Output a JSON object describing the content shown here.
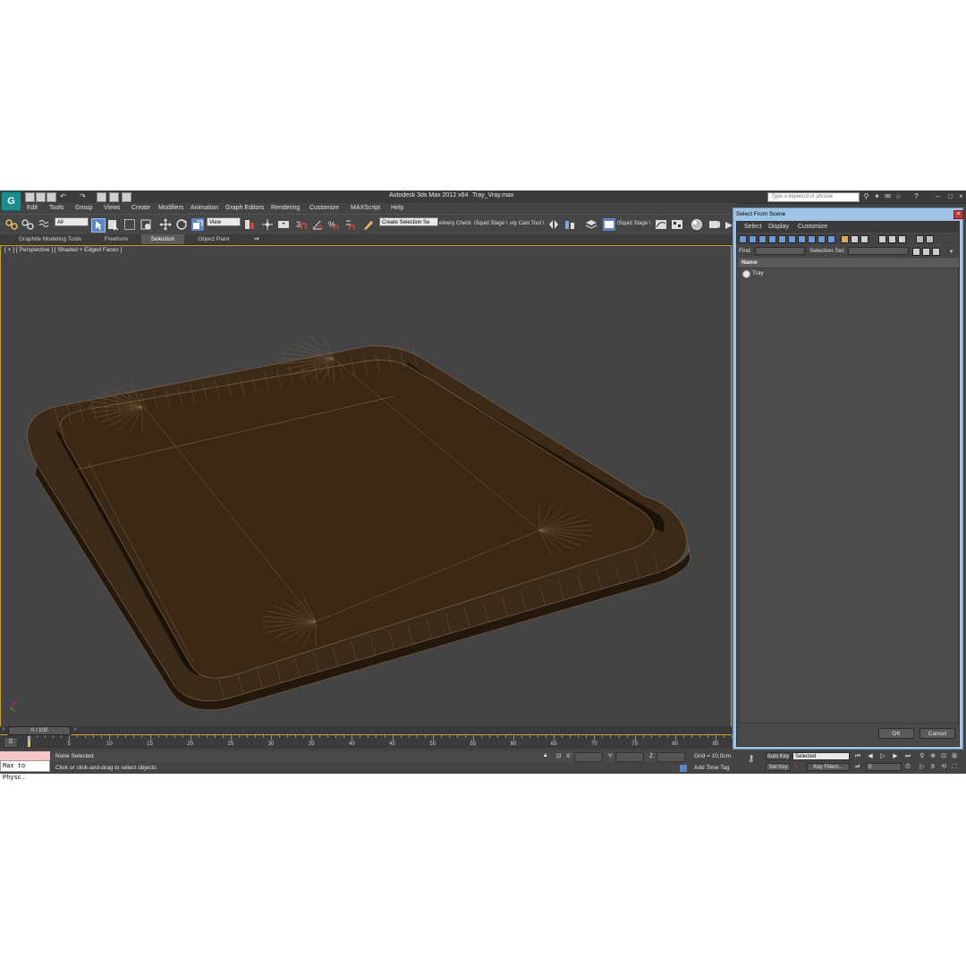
{
  "window": {
    "app_title": "Autodesk 3ds Max  2012 x64",
    "file_name": "Tray_Vray.max",
    "search_placeholder": "Type a keyword or phrase",
    "logo_icon": "3ds-max-logo-icon"
  },
  "menu": [
    "Edit",
    "Tools",
    "Group",
    "Views",
    "Create",
    "Modifiers",
    "Animation",
    "Graph Editors",
    "Rendering",
    "Customize",
    "MAXScript",
    "Help"
  ],
  "toolbar": {
    "filter_value": "All",
    "ref_coord_value": "View",
    "named_selection_value": "Create Selection Se",
    "text_items": [
      "elivery Check",
      "iSquid Stage \\",
      "uty Cam Tool \\",
      "iSquid Stage \\"
    ]
  },
  "ribbon_tabs": [
    {
      "label": "Graphite Modeling Tools",
      "active": false
    },
    {
      "label": "Freeform",
      "active": false
    },
    {
      "label": "Selection",
      "active": true
    },
    {
      "label": "Object Paint",
      "active": false
    }
  ],
  "viewport": {
    "label": "[ + ] [ Perspective ] [ Shaded + Edged Faces ]",
    "object_color": "#3a2814",
    "edge_color": "#8b7155"
  },
  "timeline": {
    "frame_display": "0 / 100",
    "tick_labels": [
      "0",
      "5",
      "10",
      "15",
      "20",
      "25",
      "30",
      "35",
      "40",
      "45",
      "50",
      "55",
      "60",
      "65",
      "70",
      "75",
      "80",
      "85"
    ]
  },
  "status": {
    "selection_text": "None Selected",
    "prompt_text": "Click or click-and-drag to select objects",
    "x_label": "X:",
    "y_label": "Y:",
    "z_label": "Z:",
    "grid_text": "Grid = 10,0cm",
    "add_time_tag": "Add Time Tag",
    "maxscript_listener": "Max to Physc."
  },
  "anim_controls": {
    "auto_key": "Auto Key",
    "set_key": "Set Key",
    "selected_dropdown": "Selected",
    "key_filters": "Key Filters...",
    "current_frame": "0"
  },
  "dialog": {
    "title": "Select From Scene",
    "menu": [
      "Select",
      "Display",
      "Customize"
    ],
    "find_label": "Find:",
    "selection_set_label": "Selection Set:",
    "column_header": "Name",
    "items": [
      "Tray"
    ],
    "ok_label": "OK",
    "cancel_label": "Cancel"
  }
}
